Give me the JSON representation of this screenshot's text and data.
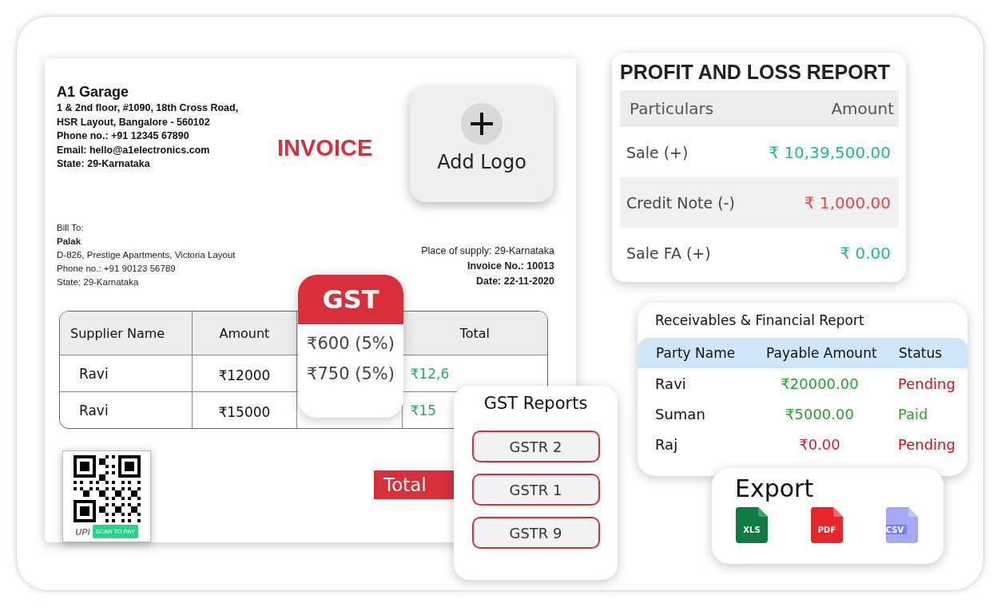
{
  "invoice": {
    "business_name": "A1 Garage",
    "address_lines": [
      "1 & 2nd floor, #1090, 18th Cross Road,",
      "HSR Layout, Bangalore - 560102",
      "Phone no.: +91 12345 67890",
      "Email: hello@a1electronics.com",
      "State: 29-Karnataka"
    ],
    "title": "INVOICE",
    "bill_to": {
      "label": "Bill To:",
      "name": "Palak",
      "lines": [
        "D-826, Prestige Apartments, Victoria Layout",
        "Phone no.: +91 90123 56789",
        "State: 29-Karnataka"
      ]
    },
    "place_of_supply": "Place of supply: 29-Karnataka",
    "invoice_no": "Invoice No.: 10013",
    "date": "Date: 22-11-2020",
    "table": {
      "columns": [
        "Supplier Name",
        "Amount",
        "Total"
      ],
      "rows": [
        {
          "supplier": "Ravi",
          "amount": "₹12000",
          "total": "₹12,6"
        },
        {
          "supplier": "Ravi",
          "amount": "₹15000",
          "total": "₹15"
        }
      ]
    },
    "upi": {
      "logo": "UPI",
      "button": "SCAN TO PAY"
    },
    "total_label": "Total"
  },
  "gst": {
    "title": "GST",
    "values": [
      "₹600 (5%)",
      "₹750 (5%)"
    ]
  },
  "add_logo": {
    "label": "Add Logo"
  },
  "profit_and_loss": {
    "title": "PROFIT AND LOSS REPORT",
    "columns": [
      "Particulars",
      "Amount"
    ],
    "rows": [
      {
        "particular": "Sale (+)",
        "amount": "₹ 10,39,500.00",
        "color": "#1fb89a"
      },
      {
        "particular": "Credit Note (-)",
        "amount": "₹ 1,000.00",
        "color": "#e8454f"
      },
      {
        "particular": "Sale FA (+)",
        "amount": "₹ 0.00",
        "color": "#1fb89a"
      }
    ]
  },
  "receivables": {
    "title": "Receivables & Financial Report",
    "columns": [
      "Party Name",
      "Payable Amount",
      "Status"
    ],
    "rows": [
      {
        "party": "Ravi",
        "amount": {
          "text": "₹20000.00",
          "color": "#22a52a"
        },
        "status": {
          "text": "Pending",
          "color": "#d0101a"
        }
      },
      {
        "party": "Suman",
        "amount": {
          "text": "₹5000.00",
          "color": "#22a52a"
        },
        "status": {
          "text": "Paid",
          "color": "#2aa52a"
        }
      },
      {
        "party": "Raj",
        "amount": {
          "text": "₹0.00",
          "color": "#d81b3c"
        },
        "status": {
          "text": "Pending",
          "color": "#d0101a"
        }
      }
    ]
  },
  "gst_reports": {
    "title": "GST Reports",
    "items": [
      "GSTR 2",
      "GSTR 1",
      "GSTR 9"
    ]
  },
  "export": {
    "title": "Export",
    "formats": [
      {
        "label": "XLS",
        "kind": "xls"
      },
      {
        "label": "PDF",
        "kind": "pdf"
      },
      {
        "label": "CSV",
        "kind": "csv"
      }
    ]
  }
}
